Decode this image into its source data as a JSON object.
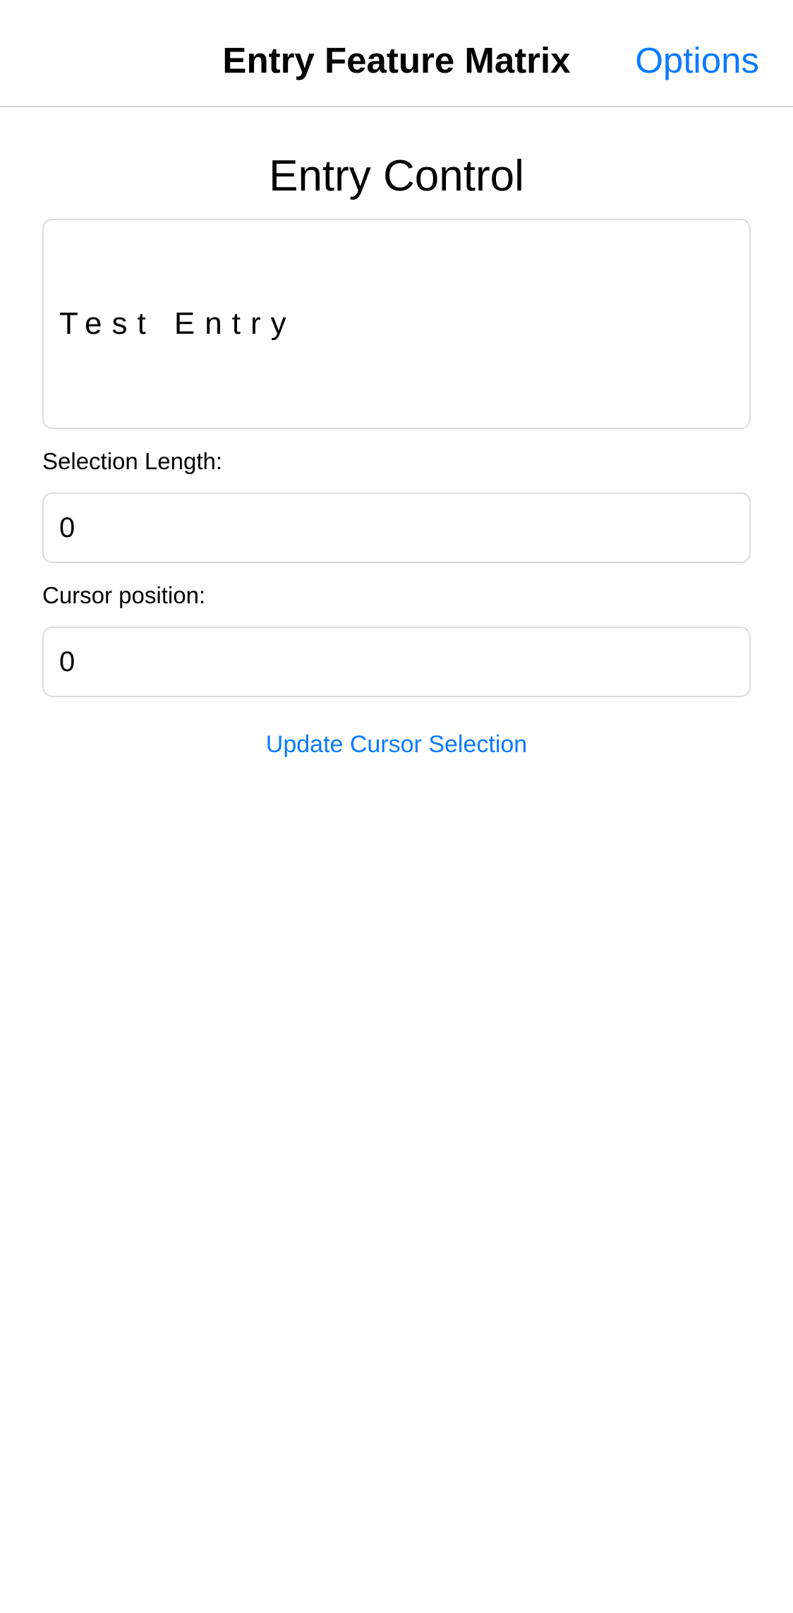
{
  "colors": {
    "accent": "#0a7aff",
    "text": "#000000",
    "border": "#dcdcdf",
    "divider": "#cfcfd3",
    "background": "#ffffff"
  },
  "navbar": {
    "title": "Entry Feature Matrix",
    "options_label": "Options"
  },
  "main": {
    "heading": "Entry Control",
    "entry": {
      "value": "Test Entry"
    },
    "selection_length": {
      "label": "Selection Length:",
      "value": "0"
    },
    "cursor_position": {
      "label": "Cursor position:",
      "value": "0"
    },
    "update_button_label": "Update Cursor Selection"
  }
}
